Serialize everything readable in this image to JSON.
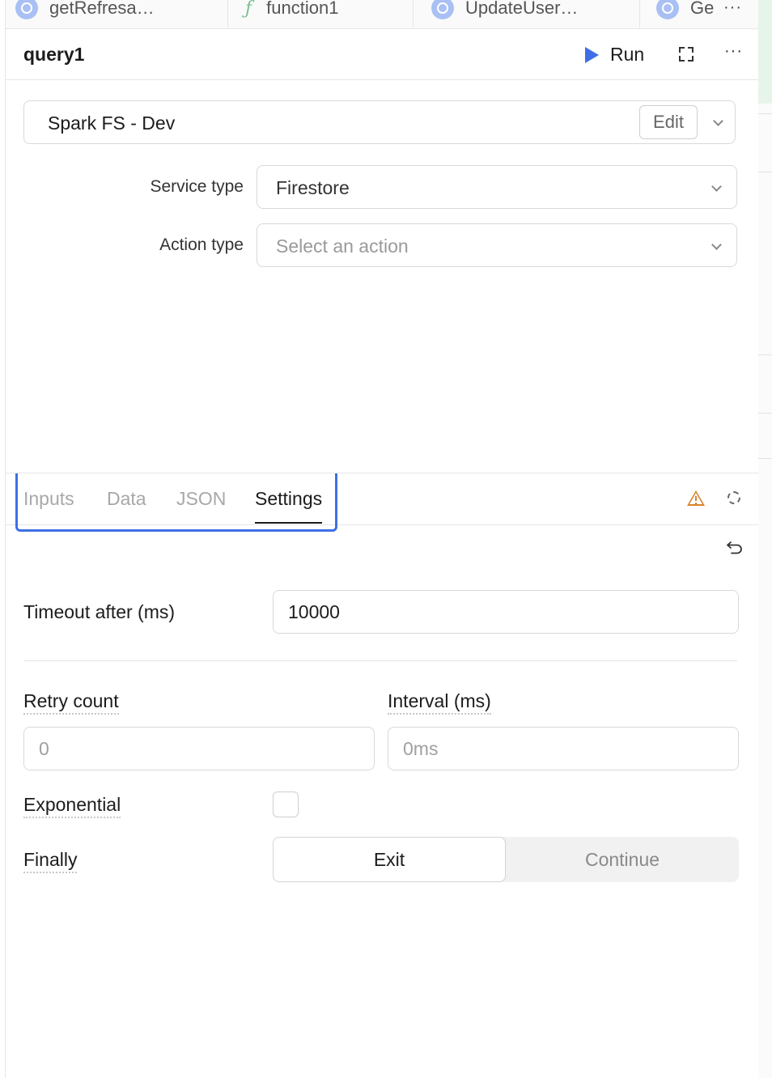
{
  "tabs": [
    {
      "label": "getRefresa…",
      "icon": "query-icon"
    },
    {
      "label": "function1",
      "icon": "function-icon"
    },
    {
      "label": "UpdateUser…",
      "icon": "query-icon"
    },
    {
      "label": "Ge",
      "icon": "query-icon"
    }
  ],
  "header": {
    "query_name": "query1",
    "run_label": "Run"
  },
  "resource": {
    "name": "Spark FS - Dev",
    "edit_label": "Edit"
  },
  "service_type": {
    "label": "Service type",
    "value": "Firestore"
  },
  "action_type": {
    "label": "Action type",
    "placeholder": "Select an action"
  },
  "lower_tabs": [
    "Inputs",
    "Data",
    "JSON",
    "Settings"
  ],
  "active_lower_tab": "Settings",
  "settings": {
    "timeout_label": "Timeout after (ms)",
    "timeout_value": "10000",
    "retry_count_label": "Retry count",
    "retry_count_placeholder": "0",
    "interval_label": "Interval (ms)",
    "interval_placeholder": "0ms",
    "exponential_label": "Exponential",
    "exponential_checked": false,
    "finally_label": "Finally",
    "finally_options": [
      "Exit",
      "Continue"
    ],
    "finally_selected": "Exit"
  },
  "colors": {
    "accent": "#3f6fe6",
    "warning": "#d9822b"
  }
}
